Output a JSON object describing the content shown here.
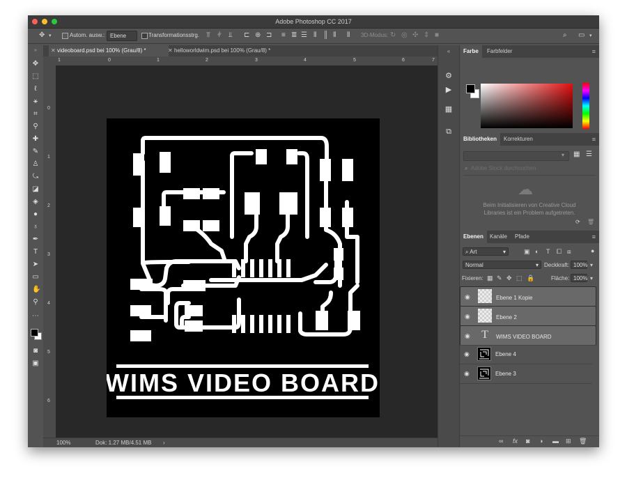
{
  "app": {
    "title": "Adobe Photoshop CC 2017"
  },
  "options_bar": {
    "auto_select_label": "Autom. ausw.:",
    "auto_select_value": "Ebene",
    "transform_label": "Transformationsstrg.",
    "mode_3d_label": "3D-Modus:"
  },
  "doc_tabs": [
    {
      "label": "videoboard.psd bei 100% (Grau/8) *",
      "active": true
    },
    {
      "label": "helloworldwim.psd bei 100% (Grau/8) *",
      "active": false
    }
  ],
  "rulers": {
    "horizontal": [
      "1",
      "0",
      "1",
      "2",
      "3",
      "4",
      "5",
      "6",
      "7"
    ],
    "vertical": [
      "0",
      "1",
      "2",
      "3",
      "4",
      "5",
      "6"
    ]
  },
  "artwork": {
    "text": "WIMS VIDEO BOARD"
  },
  "status": {
    "zoom": "100%",
    "doc": "Dok: 1.27 MB/4.51 MB"
  },
  "panels": {
    "color": {
      "tabs": [
        "Farbe",
        "Farbfelder"
      ]
    },
    "libraries": {
      "tabs": [
        "Bibliotheken",
        "Korrekturen"
      ],
      "search_placeholder": "Adobe Stock durchsuchen",
      "error_line1": "Beim Initialisieren von Creative Cloud",
      "error_line2": "Libraries ist ein Problem aufgetreten."
    },
    "layers": {
      "tabs": [
        "Ebenen",
        "Kanäle",
        "Pfade"
      ],
      "filter": "Art",
      "blend_mode": "Normal",
      "opacity_label": "Deckkraft:",
      "opacity": "100%",
      "lock_label": "Fixieren:",
      "fill_label": "Fläche:",
      "fill": "100%",
      "items": [
        {
          "name": "Ebene 1 Kopie",
          "kind": "empty",
          "selected": true
        },
        {
          "name": "Ebene 2",
          "kind": "empty",
          "selected": true
        },
        {
          "name": "WIMS VIDEO BOARD",
          "kind": "text",
          "selected": true
        },
        {
          "name": "Ebene 4",
          "kind": "image",
          "selected": false
        },
        {
          "name": "Ebene 3",
          "kind": "image",
          "selected": false
        }
      ]
    }
  },
  "colors": {
    "ui_bg": "#535353",
    "canvas_bg": "#282828",
    "artboard": "#000000",
    "ink": "#ffffff",
    "hue_accent": "#e11010"
  }
}
